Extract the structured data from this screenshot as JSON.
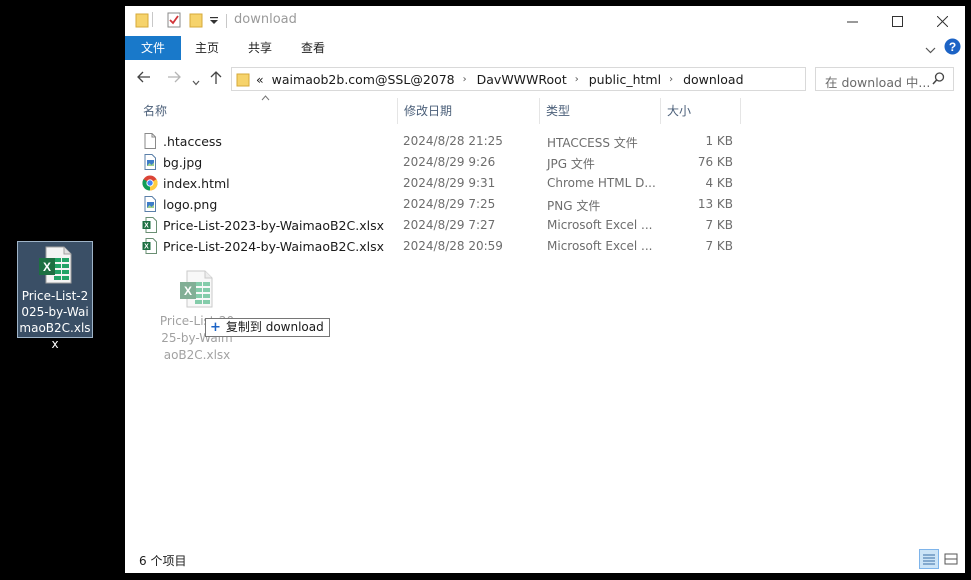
{
  "desktop": {
    "icon_label": "Price-List-2025-by-WaimaoB2C.xlsx",
    "icon": "excel-file-icon"
  },
  "window": {
    "title": "download",
    "quick_access": [
      "folder-icon",
      "properties-check-icon",
      "new-folder-icon",
      "customize-dropdown-icon"
    ],
    "controls": [
      "minimize-icon",
      "maximize-icon",
      "close-icon"
    ]
  },
  "ribbon": {
    "file_tab": "文件",
    "tabs": [
      "主页",
      "共享",
      "查看"
    ],
    "expand_icon": "chevron-down-icon",
    "help_icon": "help-icon"
  },
  "address": {
    "overflow": "«",
    "crumbs": [
      "waimaob2b.com@SSL@2078",
      "DavWWWRoot",
      "public_html",
      "download"
    ],
    "search_placeholder": "在 download 中..."
  },
  "columns": {
    "name": "名称",
    "modified": "修改日期",
    "type": "类型",
    "size": "大小"
  },
  "files": [
    {
      "name": ".htaccess",
      "modified": "2024/8/28 21:25",
      "type": "HTACCESS 文件",
      "size": "1 KB",
      "icon": "generic-file-icon"
    },
    {
      "name": "bg.jpg",
      "modified": "2024/8/29 9:26",
      "type": "JPG 文件",
      "size": "76 KB",
      "icon": "image-file-icon"
    },
    {
      "name": "index.html",
      "modified": "2024/8/29 9:31",
      "type": "Chrome HTML D...",
      "size": "4 KB",
      "icon": "chrome-icon"
    },
    {
      "name": "logo.png",
      "modified": "2024/8/29 7:25",
      "type": "PNG 文件",
      "size": "13 KB",
      "icon": "image-file-icon"
    },
    {
      "name": "Price-List-2023-by-WaimaoB2C.xlsx",
      "modified": "2024/8/29 7:27",
      "type": "Microsoft Excel ...",
      "size": "7 KB",
      "icon": "excel-file-icon"
    },
    {
      "name": "Price-List-2024-by-WaimaoB2C.xlsx",
      "modified": "2024/8/28 20:59",
      "type": "Microsoft Excel ...",
      "size": "7 KB",
      "icon": "excel-file-icon"
    }
  ],
  "drag": {
    "ghost_label": "Price-List-2025-by-WaimaoB2C.xlsx",
    "tooltip": "复制到 download"
  },
  "status": {
    "count": "6 个项目"
  },
  "colors": {
    "file_tab": "#1979ca",
    "help": "#1c63c5",
    "excel_green": "#1d6f42",
    "header_text": "#4c607a"
  }
}
